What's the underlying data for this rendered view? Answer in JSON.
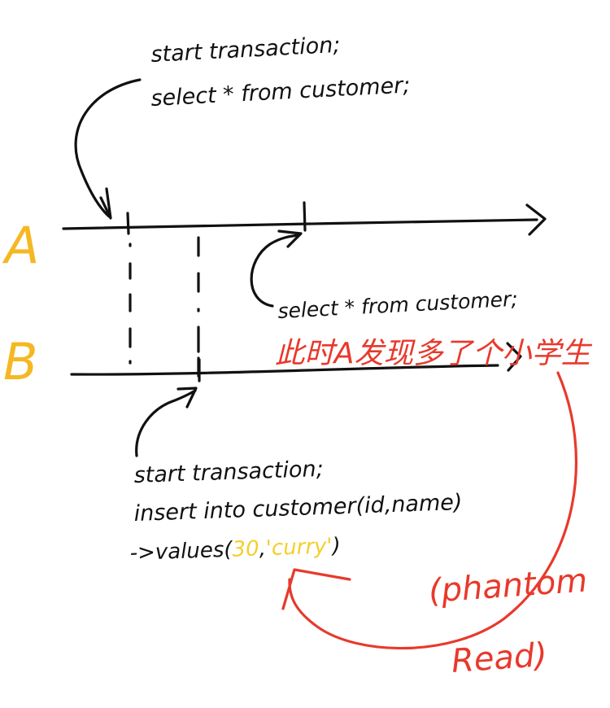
{
  "colors": {
    "ink": "#111111",
    "label_orange": "#f5b823",
    "annotation_red": "#e8392c",
    "value_yellow": "#f3cf2c"
  },
  "labels": {
    "a": "A",
    "b": "B"
  },
  "top_note": {
    "line1": "start transaction;",
    "line2": "select * from customer;"
  },
  "mid_note": {
    "line1": "select * from customer;"
  },
  "red_note": {
    "chinese": "此时A发现多了个小学生",
    "phantom": "(phantom",
    "read": "Read)"
  },
  "bottom_note": {
    "line1": "start transaction;",
    "line2": "insert into customer(id,name)",
    "line3_prefix": "->values(",
    "line3_id": "30",
    "line3_sep": ",",
    "line3_name": "'curry'",
    "line3_suffix": ")"
  }
}
